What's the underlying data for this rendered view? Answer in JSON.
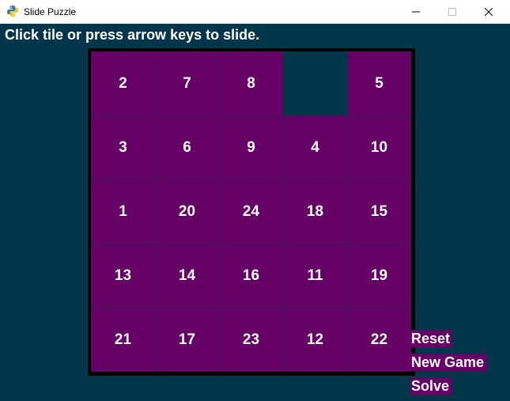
{
  "window": {
    "title": "Slide Puzzle",
    "icon": "python-icon",
    "controls": [
      "minimize-icon",
      "maximize-icon",
      "close-icon"
    ]
  },
  "game": {
    "instructions": "Click tile or press arrow keys to slide.",
    "board_rows": 5,
    "board_cols": 5,
    "tiles": [
      [
        "2",
        "7",
        "8",
        "",
        "5"
      ],
      [
        "3",
        "6",
        "9",
        "4",
        "10"
      ],
      [
        "1",
        "20",
        "24",
        "18",
        "15"
      ],
      [
        "13",
        "14",
        "16",
        "11",
        "19"
      ],
      [
        "21",
        "17",
        "23",
        "12",
        "22"
      ]
    ],
    "buttons": {
      "reset": "Reset",
      "new_game": "New Game",
      "solve": "Solve"
    }
  },
  "colors": {
    "background": "#03364a",
    "tile": "#660066",
    "tile_border": "#4d1060",
    "board_border": "#000000",
    "text": "#ffffff"
  }
}
